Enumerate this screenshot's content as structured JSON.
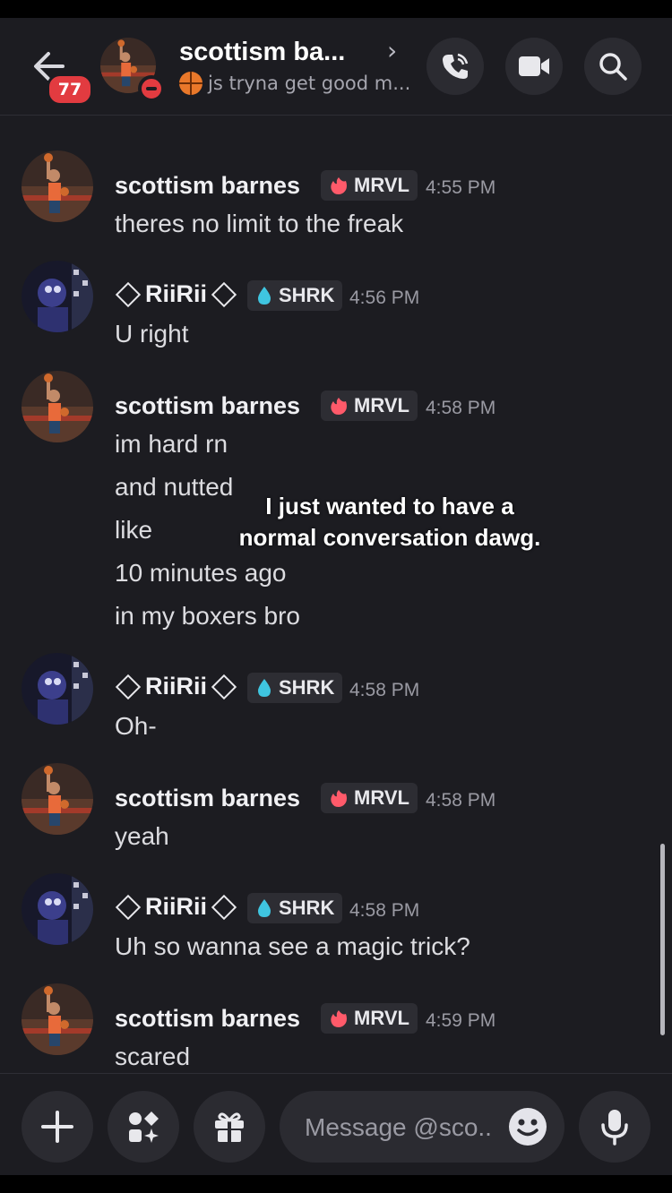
{
  "header": {
    "title": "scottism ba...",
    "status": "js tryna get good m...",
    "unread_count": "77"
  },
  "messages": [
    {
      "user": "scottism barnes",
      "tag": "MRVL",
      "time": "4:55 PM",
      "lines": [
        "theres no limit to the freak"
      ]
    },
    {
      "user": "RiiRii",
      "tag": "SHRK",
      "time": "4:56 PM",
      "lines": [
        "U right"
      ]
    },
    {
      "user": "scottism barnes",
      "tag": "MRVL",
      "time": "4:58 PM",
      "lines": [
        "im hard rn",
        "and nutted",
        "like",
        "10 minutes ago",
        "in my boxers bro"
      ]
    },
    {
      "user": "RiiRii",
      "tag": "SHRK",
      "time": "4:58 PM",
      "lines": [
        "Oh-"
      ]
    },
    {
      "user": "scottism barnes",
      "tag": "MRVL",
      "time": "4:58 PM",
      "lines": [
        "yeah"
      ]
    },
    {
      "user": "RiiRii",
      "tag": "SHRK",
      "time": "4:58 PM",
      "lines": [
        "Uh so wanna see a magic trick?"
      ]
    },
    {
      "user": "scottism barnes",
      "tag": "MRVL",
      "time": "4:59 PM",
      "lines": [
        "scared"
      ]
    }
  ],
  "overlay_caption": "I just wanted to have a normal conversation dawg.",
  "composer": {
    "placeholder": "Message @sco.."
  },
  "colors": {
    "background": "#1c1c21",
    "button": "#2b2b31",
    "badge": "#e23b40",
    "shrk_drop": "#3fc5e0",
    "mrvl_fire": "#ff5a6a"
  }
}
